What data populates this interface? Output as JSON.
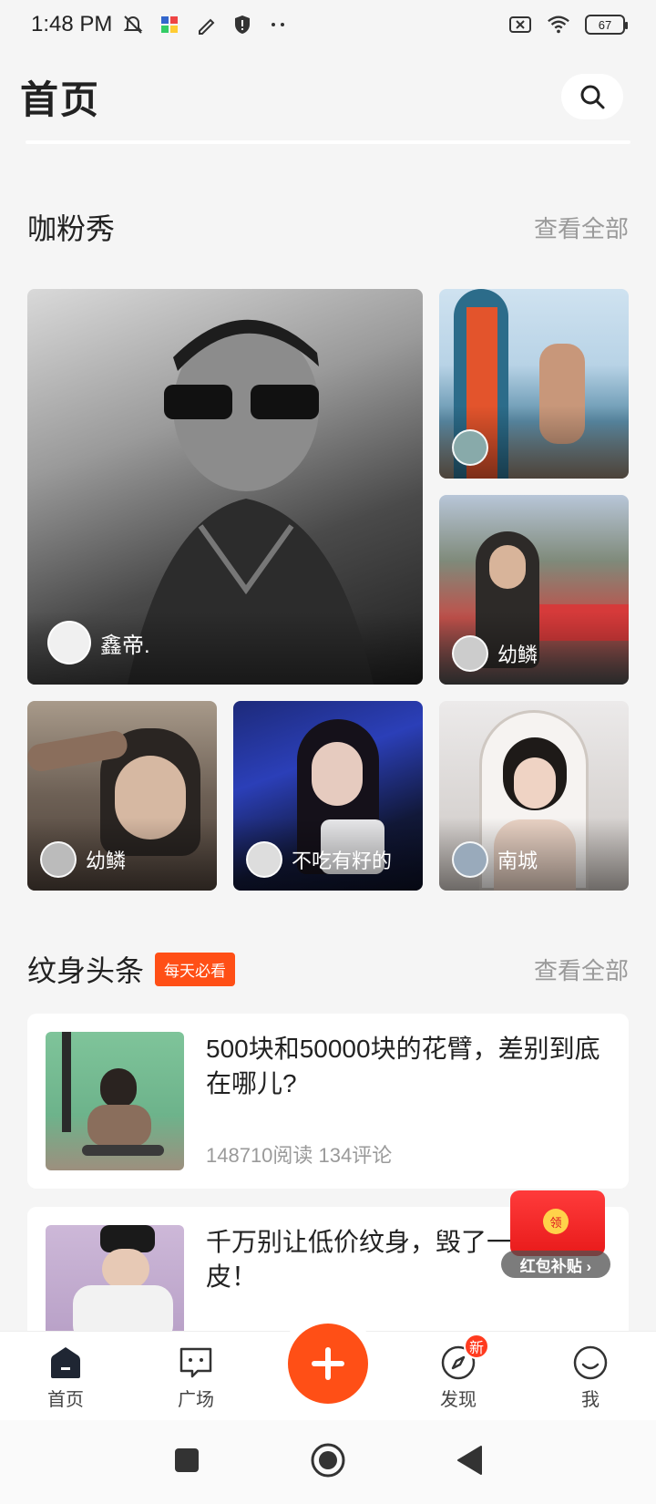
{
  "status": {
    "time": "1:48 PM",
    "battery": "67"
  },
  "header": {
    "title": "首页"
  },
  "showcase": {
    "title": "咖粉秀",
    "see_all": "查看全部",
    "items": [
      {
        "name": "鑫帝."
      },
      {
        "name": ""
      },
      {
        "name": "幼鳞"
      },
      {
        "name": "幼鳞"
      },
      {
        "name": "不吃有籽的"
      },
      {
        "name": "南城"
      }
    ]
  },
  "headlines": {
    "title": "纹身头条",
    "badge": "每天必看",
    "see_all": "查看全部",
    "articles": [
      {
        "title": "500块和50000块的花臂，差别到底在哪儿?",
        "meta": "148710阅读 134评论"
      },
      {
        "title": "千万别让低价纹身，毁了一身好皮！",
        "meta": ""
      }
    ]
  },
  "red_packet": {
    "coin": "领",
    "label": "红包补贴 ›"
  },
  "tabs": [
    {
      "label": "首页"
    },
    {
      "label": "广场"
    },
    {
      "label": "发现",
      "badge": "新"
    },
    {
      "label": "我"
    }
  ]
}
